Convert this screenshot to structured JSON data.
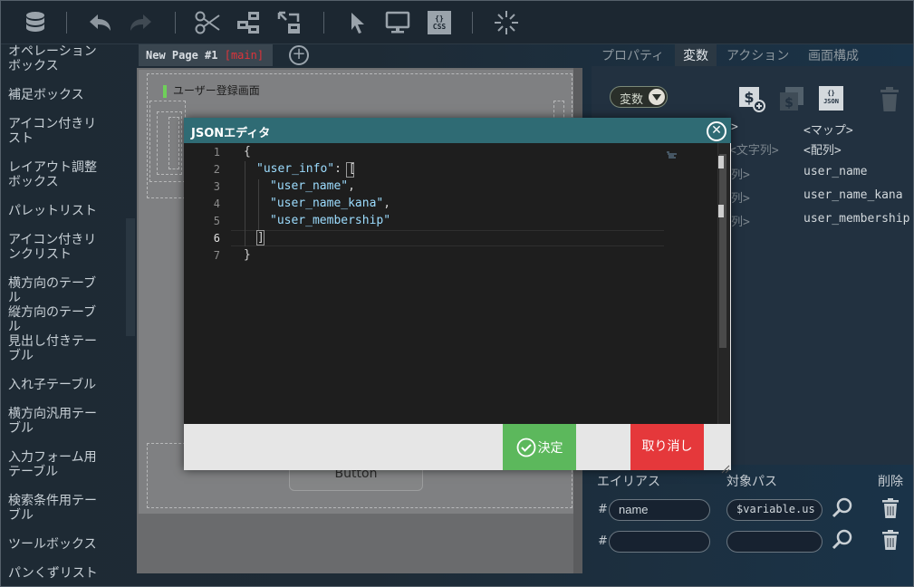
{
  "toolbar": {
    "icons": [
      "database-icon",
      "undo-icon",
      "redo-icon",
      "cut-icon",
      "component-icon",
      "import-icon",
      "select-pointer-icon",
      "preview-monitor-icon",
      "css-icon",
      "loading-spinner-icon"
    ],
    "css_label": "CSS"
  },
  "palette": {
    "items": [
      "オペレーションボックス",
      "補足ボックス",
      "アイコン付きリスト",
      "レイアウト調整ボックス",
      "パレットリスト",
      "アイコン付きリンクリスト",
      "横方向のテーブル",
      "縦方向のテーブル",
      "見出し付きテーブル",
      "入れ子テーブル",
      "横方向汎用テーブル",
      "入力フォーム用テーブル",
      "検索条件用テーブル",
      "ツールボックス",
      "パンくずリスト"
    ]
  },
  "canvas": {
    "tab_title": "New Page #1",
    "tab_branch": "[main]",
    "screen_label": "ユーザー登録画面",
    "button_label": "Button"
  },
  "right_panel": {
    "tabs": [
      "プロパティ",
      "変数",
      "アクション",
      "画面構成"
    ],
    "active_tab": "変数",
    "variable_dropdown": "変数",
    "var_rows": [
      {
        "left": ">",
        "right": "<マップ>"
      },
      {
        "left": "<文字列>",
        "right": "<配列>"
      },
      {
        "left": "列>",
        "right": "user_name"
      },
      {
        "left": "列>",
        "right": "user_name_kana"
      },
      {
        "left": "列>",
        "right": "user_membership"
      }
    ],
    "alias_header": {
      "alias": "エイリアス",
      "path": "対象パス",
      "delete": "削除"
    },
    "alias_rows": [
      {
        "hash": "#",
        "alias": "name",
        "path": "$variable.us"
      },
      {
        "hash": "#",
        "alias": "",
        "path": ""
      }
    ],
    "json_icon_label": "JSON"
  },
  "modal": {
    "title": "JSONエディタ",
    "line_numbers": [
      "1",
      "2",
      "3",
      "4",
      "5",
      "6",
      "7"
    ],
    "ok_label": "決定",
    "cancel_label": "取り消し",
    "code": {
      "l1": "{",
      "l2_key": "\"user_info\"",
      "l2_rest": ": ",
      "l2_bracket": "[",
      "l3": "\"user_name\"",
      "l4": "\"user_name_kana\"",
      "l5": "\"user_membership\"",
      "l6": "]",
      "l7": "}",
      "comma": ","
    }
  },
  "colors": {
    "modal_header": "#2f6b74",
    "ok_button": "#5cb85c",
    "cancel_button": "#e5383b",
    "editor_bg": "#1e1e1e",
    "string": "#9cdcfe"
  }
}
